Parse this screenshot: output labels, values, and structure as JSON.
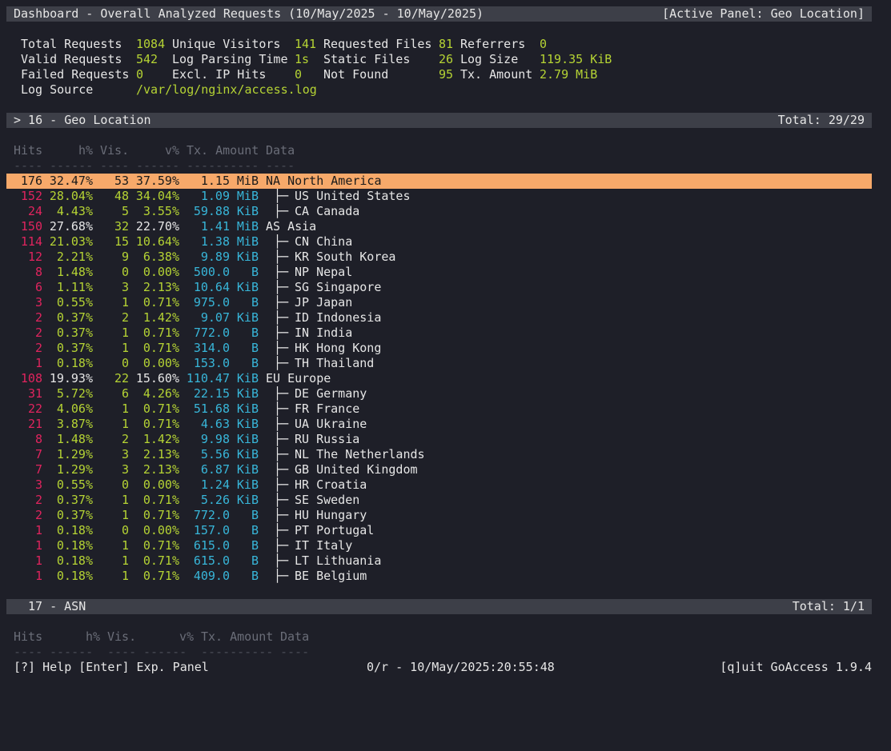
{
  "header": {
    "title": "Dashboard - Overall Analyzed Requests (10/May/2025 - 10/May/2025)",
    "active": "[Active Panel: Geo Location]"
  },
  "stats": {
    "rows": [
      [
        {
          "l": "Total Requests",
          "v": "1084"
        },
        {
          "l": "Unique Visitors",
          "v": "141"
        },
        {
          "l": "Requested Files",
          "v": "81"
        },
        {
          "l": "Referrers",
          "v": "0"
        }
      ],
      [
        {
          "l": "Valid Requests",
          "v": "542"
        },
        {
          "l": "Log Parsing Time",
          "v": "1s"
        },
        {
          "l": "Static Files",
          "v": "26"
        },
        {
          "l": "Log Size",
          "v": "119.35 KiB"
        }
      ],
      [
        {
          "l": "Failed Requests",
          "v": "0"
        },
        {
          "l": "Excl. IP Hits",
          "v": "0"
        },
        {
          "l": "Not Found",
          "v": "95"
        },
        {
          "l": "Tx. Amount",
          "v": "2.79 MiB"
        }
      ]
    ],
    "log_source_label": "Log Source",
    "log_source": "/var/log/nginx/access.log"
  },
  "panel16": {
    "title": "> 16 - Geo Location",
    "total": "Total: 29/29",
    "headers": {
      "hits": "Hits",
      "hp": "h%",
      "vis": "Vis.",
      "vp": "v%",
      "tx": "Tx. Amount",
      "data": "Data"
    },
    "dashes": {
      "hits": "----",
      "hp": "------",
      "vis": "----",
      "vp": "------",
      "tx": "----------",
      "data": "----"
    }
  },
  "geo_rows": [
    {
      "hits": "176",
      "hp": "32.47%",
      "vis": "53",
      "vp": "37.59%",
      "amt": "1.15",
      "unit": "MiB",
      "tree": "",
      "data": "NA North America",
      "group": true,
      "selected": true
    },
    {
      "hits": "152",
      "hp": "28.04%",
      "vis": "48",
      "vp": "34.04%",
      "amt": "1.09",
      "unit": "MiB",
      "tree": "├─",
      "data": "US United States"
    },
    {
      "hits": "24",
      "hp": "4.43%",
      "vis": "5",
      "vp": "3.55%",
      "amt": "59.88",
      "unit": "KiB",
      "tree": "├─",
      "data": "CA Canada"
    },
    {
      "hits": "150",
      "hp": "27.68%",
      "vis": "32",
      "vp": "22.70%",
      "amt": "1.41",
      "unit": "MiB",
      "tree": "",
      "data": "AS Asia",
      "group": true
    },
    {
      "hits": "114",
      "hp": "21.03%",
      "vis": "15",
      "vp": "10.64%",
      "amt": "1.38",
      "unit": "MiB",
      "tree": "├─",
      "data": "CN China"
    },
    {
      "hits": "12",
      "hp": "2.21%",
      "vis": "9",
      "vp": "6.38%",
      "amt": "9.89",
      "unit": "KiB",
      "tree": "├─",
      "data": "KR South Korea"
    },
    {
      "hits": "8",
      "hp": "1.48%",
      "vis": "0",
      "vp": "0.00%",
      "amt": "500.0",
      "unit": "B",
      "tree": "├─",
      "data": "NP Nepal"
    },
    {
      "hits": "6",
      "hp": "1.11%",
      "vis": "3",
      "vp": "2.13%",
      "amt": "10.64",
      "unit": "KiB",
      "tree": "├─",
      "data": "SG Singapore"
    },
    {
      "hits": "3",
      "hp": "0.55%",
      "vis": "1",
      "vp": "0.71%",
      "amt": "975.0",
      "unit": "B",
      "tree": "├─",
      "data": "JP Japan"
    },
    {
      "hits": "2",
      "hp": "0.37%",
      "vis": "2",
      "vp": "1.42%",
      "amt": "9.07",
      "unit": "KiB",
      "tree": "├─",
      "data": "ID Indonesia"
    },
    {
      "hits": "2",
      "hp": "0.37%",
      "vis": "1",
      "vp": "0.71%",
      "amt": "772.0",
      "unit": "B",
      "tree": "├─",
      "data": "IN India"
    },
    {
      "hits": "2",
      "hp": "0.37%",
      "vis": "1",
      "vp": "0.71%",
      "amt": "314.0",
      "unit": "B",
      "tree": "├─",
      "data": "HK Hong Kong"
    },
    {
      "hits": "1",
      "hp": "0.18%",
      "vis": "0",
      "vp": "0.00%",
      "amt": "153.0",
      "unit": "B",
      "tree": "├─",
      "data": "TH Thailand"
    },
    {
      "hits": "108",
      "hp": "19.93%",
      "vis": "22",
      "vp": "15.60%",
      "amt": "110.47",
      "unit": "KiB",
      "tree": "",
      "data": "EU Europe",
      "group": true
    },
    {
      "hits": "31",
      "hp": "5.72%",
      "vis": "6",
      "vp": "4.26%",
      "amt": "22.15",
      "unit": "KiB",
      "tree": "├─",
      "data": "DE Germany"
    },
    {
      "hits": "22",
      "hp": "4.06%",
      "vis": "1",
      "vp": "0.71%",
      "amt": "51.68",
      "unit": "KiB",
      "tree": "├─",
      "data": "FR France"
    },
    {
      "hits": "21",
      "hp": "3.87%",
      "vis": "1",
      "vp": "0.71%",
      "amt": "4.63",
      "unit": "KiB",
      "tree": "├─",
      "data": "UA Ukraine"
    },
    {
      "hits": "8",
      "hp": "1.48%",
      "vis": "2",
      "vp": "1.42%",
      "amt": "9.98",
      "unit": "KiB",
      "tree": "├─",
      "data": "RU Russia"
    },
    {
      "hits": "7",
      "hp": "1.29%",
      "vis": "3",
      "vp": "2.13%",
      "amt": "5.56",
      "unit": "KiB",
      "tree": "├─",
      "data": "NL The Netherlands"
    },
    {
      "hits": "7",
      "hp": "1.29%",
      "vis": "3",
      "vp": "2.13%",
      "amt": "6.87",
      "unit": "KiB",
      "tree": "├─",
      "data": "GB United Kingdom"
    },
    {
      "hits": "3",
      "hp": "0.55%",
      "vis": "0",
      "vp": "0.00%",
      "amt": "1.24",
      "unit": "KiB",
      "tree": "├─",
      "data": "HR Croatia"
    },
    {
      "hits": "2",
      "hp": "0.37%",
      "vis": "1",
      "vp": "0.71%",
      "amt": "5.26",
      "unit": "KiB",
      "tree": "├─",
      "data": "SE Sweden"
    },
    {
      "hits": "2",
      "hp": "0.37%",
      "vis": "1",
      "vp": "0.71%",
      "amt": "772.0",
      "unit": "B",
      "tree": "├─",
      "data": "HU Hungary"
    },
    {
      "hits": "1",
      "hp": "0.18%",
      "vis": "0",
      "vp": "0.00%",
      "amt": "157.0",
      "unit": "B",
      "tree": "├─",
      "data": "PT Portugal"
    },
    {
      "hits": "1",
      "hp": "0.18%",
      "vis": "1",
      "vp": "0.71%",
      "amt": "615.0",
      "unit": "B",
      "tree": "├─",
      "data": "IT Italy"
    },
    {
      "hits": "1",
      "hp": "0.18%",
      "vis": "1",
      "vp": "0.71%",
      "amt": "615.0",
      "unit": "B",
      "tree": "├─",
      "data": "LT Lithuania"
    },
    {
      "hits": "1",
      "hp": "0.18%",
      "vis": "1",
      "vp": "0.71%",
      "amt": "409.0",
      "unit": "B",
      "tree": "├─",
      "data": "BE Belgium"
    }
  ],
  "panel17": {
    "title": "17 - ASN",
    "total": "Total: 1/1",
    "headers": {
      "hits": "Hits",
      "hp": "h%",
      "vis": "Vis.",
      "vp": "v%",
      "tx": "Tx. Amount",
      "data": "Data"
    },
    "dashes": {
      "hits": "----",
      "hp": "------",
      "vis": "----",
      "vp": "------",
      "tx": "----------",
      "data": "----"
    }
  },
  "footer": {
    "help": "[?] Help [Enter] Exp. Panel",
    "status": "0/r - 10/May/2025:20:55:48",
    "quit": "[q]uit GoAccess 1.9.4"
  },
  "colors": {
    "bg": "#1e1f28",
    "bar": "#3d3f48",
    "selected": "#f7a96a",
    "hits": "#e0245e",
    "values": "#b5d334",
    "bytes": "#38b6d9"
  }
}
